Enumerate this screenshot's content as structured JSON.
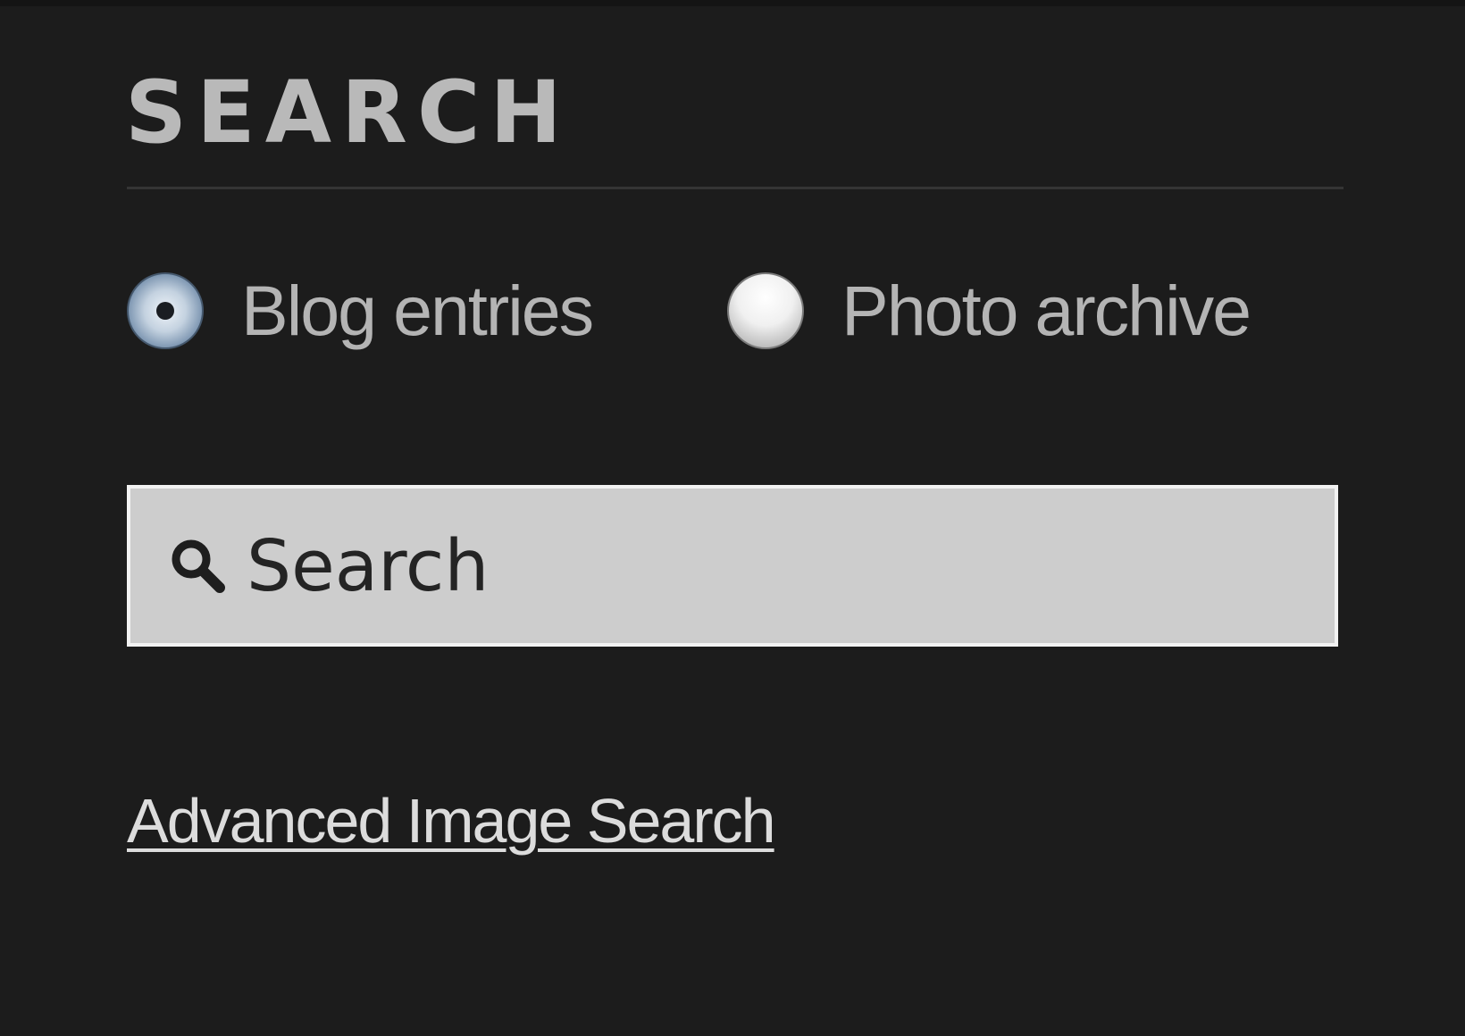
{
  "search_panel": {
    "heading": "SEARCH",
    "scope_options": [
      {
        "label": "Blog entries",
        "selected": true
      },
      {
        "label": "Photo archive",
        "selected": false
      }
    ],
    "search_field": {
      "placeholder": "Search",
      "value": ""
    },
    "advanced_link": "Advanced Image Search"
  },
  "icons": {
    "search_field_icon": "magnifier-icon"
  },
  "colors": {
    "background": "#1c1c1c",
    "heading_text": "#b9b9b9",
    "option_text": "#b4b4b4",
    "field_background": "#cdcdcd",
    "link_text": "#dcdcdc"
  }
}
